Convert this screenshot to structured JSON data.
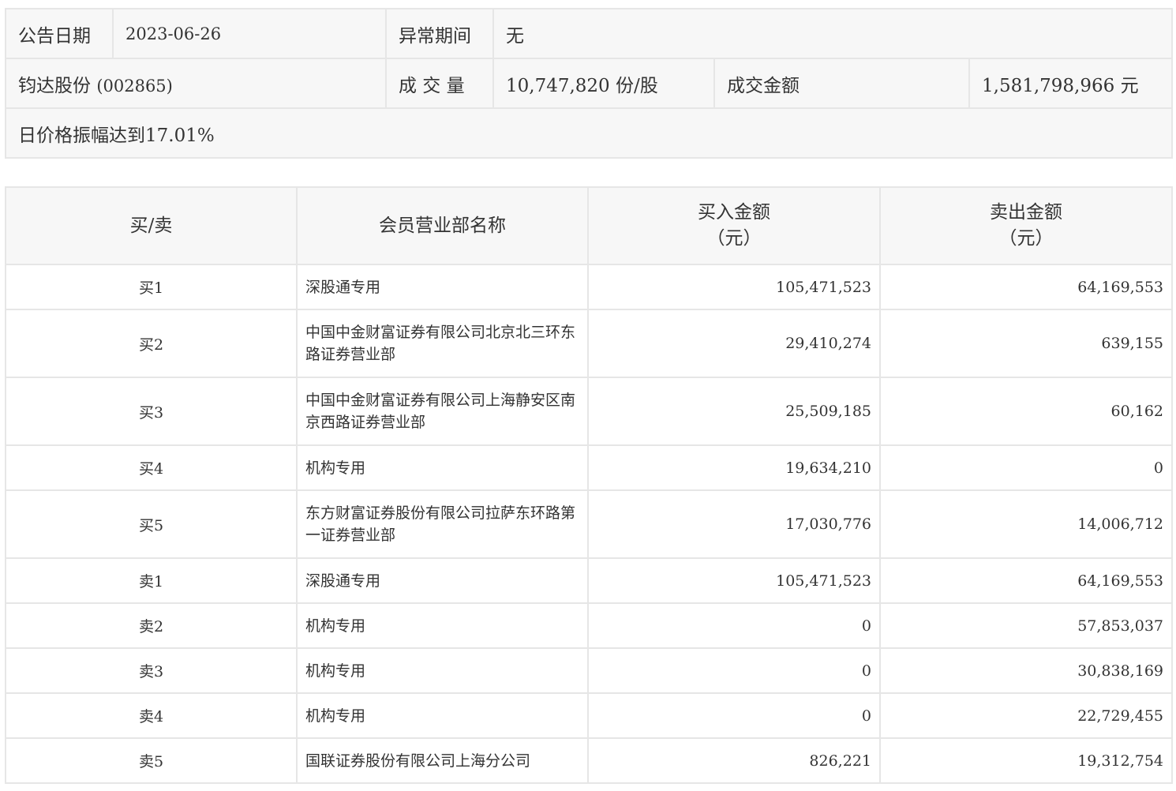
{
  "info": {
    "date_label": "公告日期",
    "date_value": "2023-06-26",
    "abnormal_label": "异常期间",
    "abnormal_value": "无",
    "stock_name": "钧达股份",
    "stock_code": "(002865)",
    "volume_label": "成 交 量",
    "volume_value": "10,747,820 份/股",
    "amount_label": "成交金额",
    "amount_value": "1,581,798,966 元",
    "reason": "日价格振幅达到17.01%"
  },
  "table": {
    "headers": {
      "side": "买/卖",
      "branch": "会员营业部名称",
      "buy_line1": "买入金额",
      "buy_line2": "（元）",
      "sell_line1": "卖出金额",
      "sell_line2": "（元）"
    },
    "rows": [
      {
        "side": "买1",
        "branch": "深股通专用",
        "buy": "105,471,523",
        "sell": "64,169,553"
      },
      {
        "side": "买2",
        "branch": "中国中金财富证券有限公司北京北三环东路证券营业部",
        "buy": "29,410,274",
        "sell": "639,155"
      },
      {
        "side": "买3",
        "branch": "中国中金财富证券有限公司上海静安区南京西路证券营业部",
        "buy": "25,509,185",
        "sell": "60,162"
      },
      {
        "side": "买4",
        "branch": "机构专用",
        "buy": "19,634,210",
        "sell": "0"
      },
      {
        "side": "买5",
        "branch": "东方财富证券股份有限公司拉萨东环路第一证券营业部",
        "buy": "17,030,776",
        "sell": "14,006,712"
      },
      {
        "side": "卖1",
        "branch": "深股通专用",
        "buy": "105,471,523",
        "sell": "64,169,553"
      },
      {
        "side": "卖2",
        "branch": "机构专用",
        "buy": "0",
        "sell": "57,853,037"
      },
      {
        "side": "卖3",
        "branch": "机构专用",
        "buy": "0",
        "sell": "30,838,169"
      },
      {
        "side": "卖4",
        "branch": "机构专用",
        "buy": "0",
        "sell": "22,729,455"
      },
      {
        "side": "卖5",
        "branch": "国联证券股份有限公司上海分公司",
        "buy": "826,221",
        "sell": "19,312,754"
      }
    ]
  }
}
